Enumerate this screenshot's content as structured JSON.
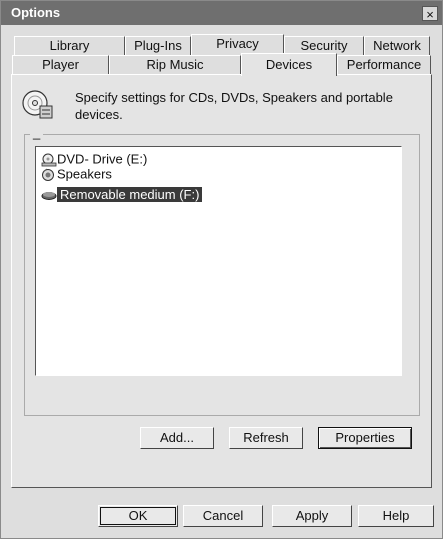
{
  "window": {
    "title": "Options",
    "close_glyph": "×"
  },
  "tabs_row1": [
    "Library",
    "Plug-Ins",
    "Privacy",
    "Security",
    "Network"
  ],
  "tabs_row2": [
    "Player",
    "Rip Music",
    "Devices",
    "Performance"
  ],
  "active_tab": "Devices",
  "description": "Specify settings for CDs, DVDs, Speakers and portable devices.",
  "group_label": "_",
  "devices": [
    {
      "label": "DVD- Drive (E:)",
      "icon": "dvd-drive-icon",
      "selected": false
    },
    {
      "label": "Speakers",
      "icon": "speaker-icon",
      "selected": false
    },
    {
      "label": "Removable medium (F:)",
      "icon": "removable-drive-icon",
      "selected": true
    }
  ],
  "device_buttons": {
    "add": "Add...",
    "refresh": "Refresh",
    "properties": "Properties"
  },
  "dialog_buttons": {
    "ok": "OK",
    "cancel": "Cancel",
    "apply": "Apply",
    "help": "Help"
  }
}
